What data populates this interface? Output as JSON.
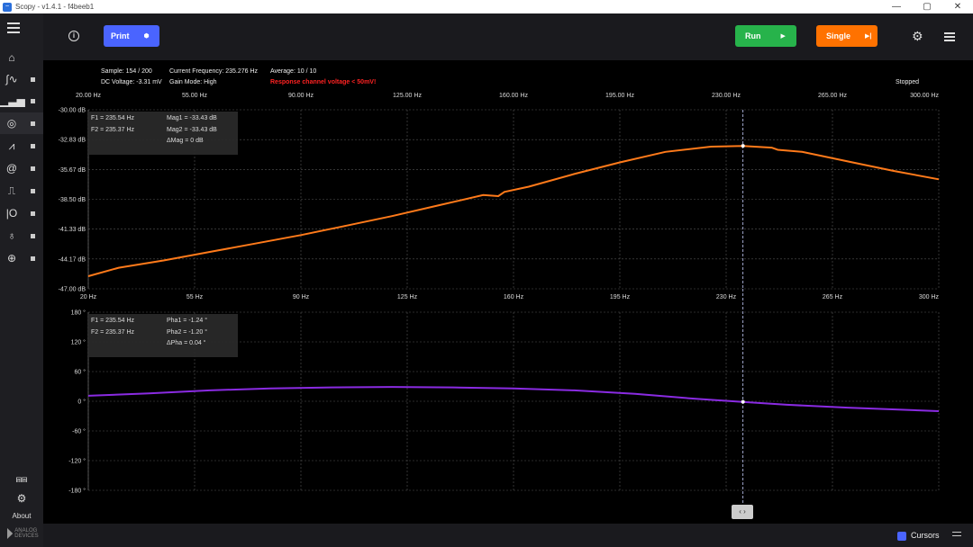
{
  "window": {
    "title": "Scopy - v1.4.1 - f4beeb1",
    "min": "—",
    "max": "▢",
    "close": "✕"
  },
  "sidebar": {
    "items": [
      {
        "icon": "home-icon",
        "glyph": "⌂"
      },
      {
        "icon": "oscilloscope-icon",
        "glyph": "∫∿"
      },
      {
        "icon": "spectrum-icon",
        "glyph": "▁▃▅"
      },
      {
        "icon": "network-analyzer-icon",
        "glyph": "◎"
      },
      {
        "icon": "signal-generator-icon",
        "glyph": "⩘"
      },
      {
        "icon": "voltmeter-icon",
        "glyph": "@"
      },
      {
        "icon": "pattern-generator-icon",
        "glyph": "⎍"
      },
      {
        "icon": "digital-io-icon",
        "glyph": "|O"
      },
      {
        "icon": "power-supply-icon",
        "glyph": "♁"
      },
      {
        "icon": "logic-analyzer-icon",
        "glyph": "⊕"
      }
    ],
    "bottom_icon": "⩎⩎",
    "settings_glyph": "⚙",
    "about_label": "About",
    "logo_text": "ANALOG DEVICES"
  },
  "toolbar": {
    "print_label": "Print",
    "run_label": "Run",
    "single_label": "Single",
    "colors": {
      "print": "#4a64ff",
      "run": "#27b34b",
      "single": "#ff7200"
    }
  },
  "status": {
    "sample": "Sample: 154 / 200",
    "dc_voltage": "DC Voltage: -3.31 mV",
    "current_frequency": "Current Frequency: 235.276 Hz",
    "gain_mode": "Gain Mode: High",
    "average": "Average: 10 / 10",
    "warning": "Response channel voltage < 50mV!",
    "state": "Stopped"
  },
  "magnitude_cursor": {
    "f1": "F1 =  235.54 Hz",
    "f2": "F2 =  235.37 Hz",
    "mag1": "Mag1 =  -33.43 dB",
    "mag2": "Mag2 =  -33.43 dB",
    "dmag": "ΔMag =  0 dB"
  },
  "phase_cursor": {
    "f1": "F1 =  235.54 Hz",
    "f2": "F2 =  235.37 Hz",
    "pha1": "Pha1 =  -1.24 °",
    "pha2": "Pha2 =  -1.20 °",
    "dpha": "ΔPha =  0.04 °"
  },
  "bottombar": {
    "cursors_label": "Cursors"
  },
  "chart_data": [
    {
      "type": "line",
      "name": "magnitude",
      "top_ticks": [
        "20.00 Hz",
        "55.00 Hz",
        "90.00 Hz",
        "125.00 Hz",
        "160.00 Hz",
        "195.00 Hz",
        "230.00 Hz",
        "265.00 Hz",
        "300.00 Hz"
      ],
      "bottom_ticks": [
        "20 Hz",
        "55 Hz",
        "90 Hz",
        "125 Hz",
        "160 Hz",
        "195 Hz",
        "230 Hz",
        "265 Hz",
        "300 Hz"
      ],
      "y_ticks": [
        "-30.00 dB",
        "-32.83 dB",
        "-35.67 dB",
        "-38.50 dB",
        "-41.33 dB",
        "-44.17 dB",
        "-47.00 dB"
      ],
      "xlim": [
        20,
        300
      ],
      "ylim": [
        -47,
        -30
      ],
      "color": "#ff7a1a",
      "x": [
        20,
        30,
        45,
        60,
        75,
        90,
        105,
        120,
        135,
        150,
        155,
        157,
        165,
        180,
        195,
        210,
        225,
        235.5,
        245,
        247,
        255,
        270,
        285,
        300
      ],
      "y": [
        -45.8,
        -45.0,
        -44.3,
        -43.5,
        -42.7,
        -41.9,
        -41.0,
        -40.1,
        -39.1,
        -38.1,
        -38.2,
        -37.8,
        -37.3,
        -36.1,
        -35.0,
        -34.0,
        -33.5,
        -33.43,
        -33.6,
        -33.8,
        -34.0,
        -34.9,
        -35.8,
        -36.6
      ],
      "cursor_x": 235.54,
      "grid": true
    },
    {
      "type": "line",
      "name": "phase",
      "y_ticks": [
        "180 °",
        "120 °",
        "60 °",
        "0 °",
        "-60 °",
        "-120 °",
        "-180 °"
      ],
      "xlim": [
        20,
        300
      ],
      "ylim": [
        -180,
        180
      ],
      "color": "#8a2be2",
      "x": [
        20,
        40,
        60,
        80,
        100,
        120,
        140,
        160,
        180,
        200,
        220,
        235.5,
        250,
        270,
        300
      ],
      "y": [
        11,
        16,
        22,
        26,
        28,
        29,
        28,
        26,
        22,
        15,
        5,
        -1.24,
        -7,
        -13,
        -20
      ],
      "cursor_x": 235.54,
      "grid": true
    }
  ]
}
